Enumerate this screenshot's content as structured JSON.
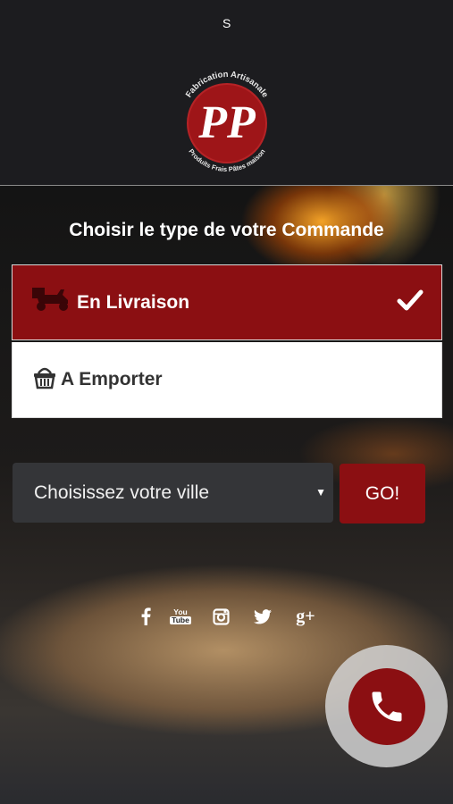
{
  "status": {
    "text": "S"
  },
  "logo": {
    "top_text": "Fabrication Artisanale",
    "monogram": "PP",
    "bottom_text": "Produits Frais Pâtes maison"
  },
  "order": {
    "heading": "Choisir le type de votre Commande",
    "options": [
      {
        "label": "En Livraison",
        "icon": "scooter-icon",
        "selected": true
      },
      {
        "label": "A Emporter",
        "icon": "basket-icon",
        "selected": false
      }
    ]
  },
  "city": {
    "placeholder": "Choisissez votre ville",
    "go_label": "GO!"
  },
  "social": [
    {
      "name": "facebook-icon"
    },
    {
      "name": "youtube-icon",
      "text_top": "You",
      "text_bottom": "Tube"
    },
    {
      "name": "instagram-icon"
    },
    {
      "name": "twitter-icon"
    },
    {
      "name": "google-plus-icon",
      "text": "g+"
    }
  ],
  "colors": {
    "accent": "#8b0f12",
    "header_bg": "#1c1c1f",
    "select_bg": "#343538"
  }
}
